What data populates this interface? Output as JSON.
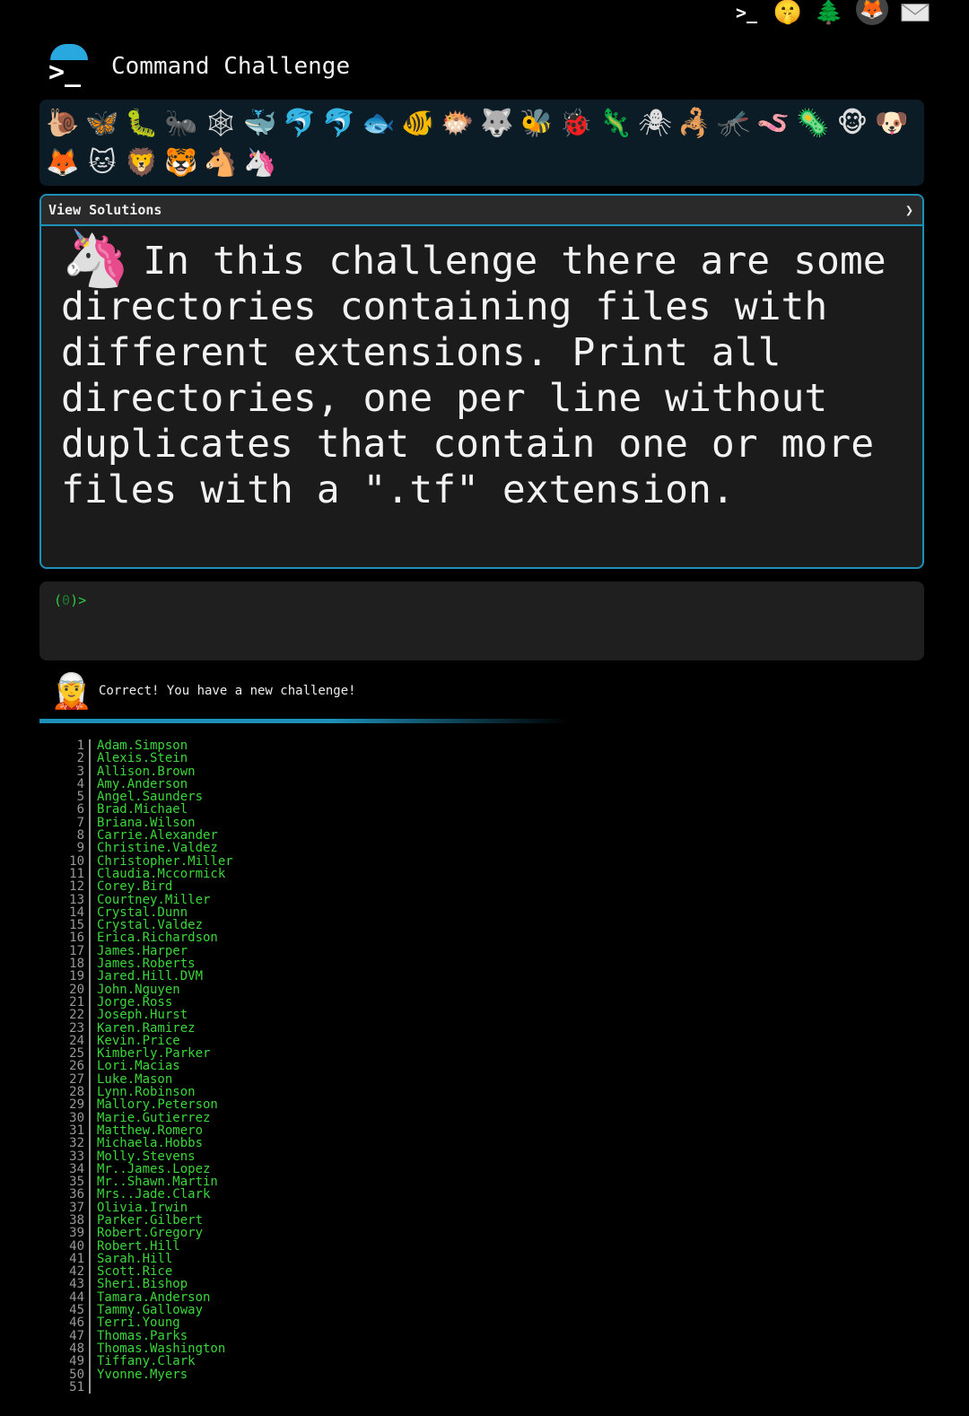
{
  "topbar": {
    "icons": [
      "terminal-icon",
      "shushing-face-icon",
      "tree-icon",
      "gitlab-icon",
      "mail-icon"
    ]
  },
  "header": {
    "title": "Command Challenge"
  },
  "animals": [
    "🐌",
    "🦋",
    "🐛",
    "🐜",
    "🕸",
    "🐳",
    "🐬",
    "🐬",
    "🐟",
    "🐠",
    "🐡",
    "🐺",
    "🐝",
    "🐞",
    "🦎",
    "🕷",
    "🦂",
    "🦟",
    "🪱",
    "🦠",
    "🐵",
    "🐶",
    "🦊",
    "🐱",
    "🦁",
    "🐯",
    "🐴",
    "🦄"
  ],
  "challenge": {
    "solutions_label": "View Solutions",
    "solutions_chevron": "❯",
    "icon": "🦄",
    "text": "In this challenge there are some directories containing files with different extensions. Print all directories, one per line without duplicates that contain one or more files with a \".tf\" extension."
  },
  "terminal": {
    "prompt_open": "(",
    "prompt_count": "0",
    "prompt_close": ")>"
  },
  "feedback": {
    "icon": "🧝",
    "message": "Correct! You have a new challenge!"
  },
  "output": [
    "Adam.Simpson",
    "Alexis.Stein",
    "Allison.Brown",
    "Amy.Anderson",
    "Angel.Saunders",
    "Brad.Michael",
    "Briana.Wilson",
    "Carrie.Alexander",
    "Christine.Valdez",
    "Christopher.Miller",
    "Claudia.Mccormick",
    "Corey.Bird",
    "Courtney.Miller",
    "Crystal.Dunn",
    "Crystal.Valdez",
    "Erica.Richardson",
    "James.Harper",
    "James.Roberts",
    "Jared.Hill.DVM",
    "John.Nguyen",
    "Jorge.Ross",
    "Joseph.Hurst",
    "Karen.Ramirez",
    "Kevin.Price",
    "Kimberly.Parker",
    "Lori.Macias",
    "Luke.Mason",
    "Lynn.Robinson",
    "Mallory.Peterson",
    "Marie.Gutierrez",
    "Matthew.Romero",
    "Michaela.Hobbs",
    "Molly.Stevens",
    "Mr..James.Lopez",
    "Mr..Shawn.Martin",
    "Mrs..Jade.Clark",
    "Olivia.Irwin",
    "Parker.Gilbert",
    "Robert.Gregory",
    "Robert.Hill",
    "Sarah.Hill",
    "Scott.Rice",
    "Sheri.Bishop",
    "Tamara.Anderson",
    "Tammy.Galloway",
    "Terri.Young",
    "Thomas.Parks",
    "Thomas.Washington",
    "Tiffany.Clark",
    "Yvonne.Myers",
    ""
  ]
}
